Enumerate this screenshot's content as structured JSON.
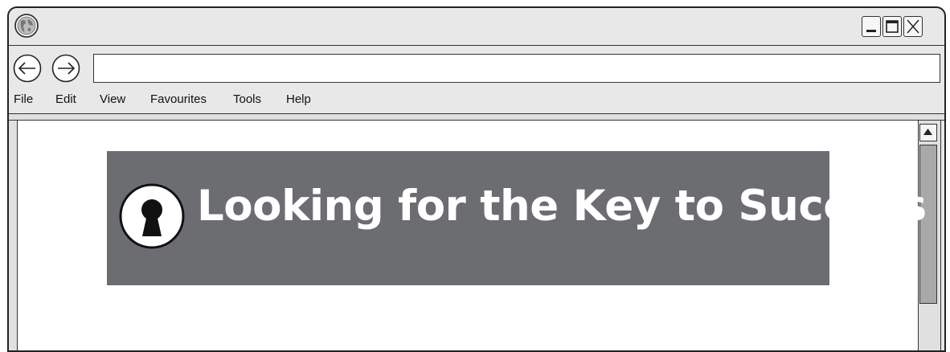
{
  "window": {
    "controls": {
      "minimize_icon": "minimize-icon",
      "maximize_icon": "maximize-icon",
      "close_icon": "close-icon"
    }
  },
  "toolbar": {
    "address_value": "",
    "back_icon": "back-arrow-icon",
    "forward_icon": "forward-arrow-icon"
  },
  "menu": {
    "items": [
      "File",
      "Edit",
      "View",
      "Favourites",
      "Tools",
      "Help"
    ]
  },
  "page": {
    "banner": {
      "title": "Looking for the Key to Success",
      "icon": "keyhole-icon",
      "background_color": "#6c6d70",
      "text_color": "#ffffff"
    }
  }
}
